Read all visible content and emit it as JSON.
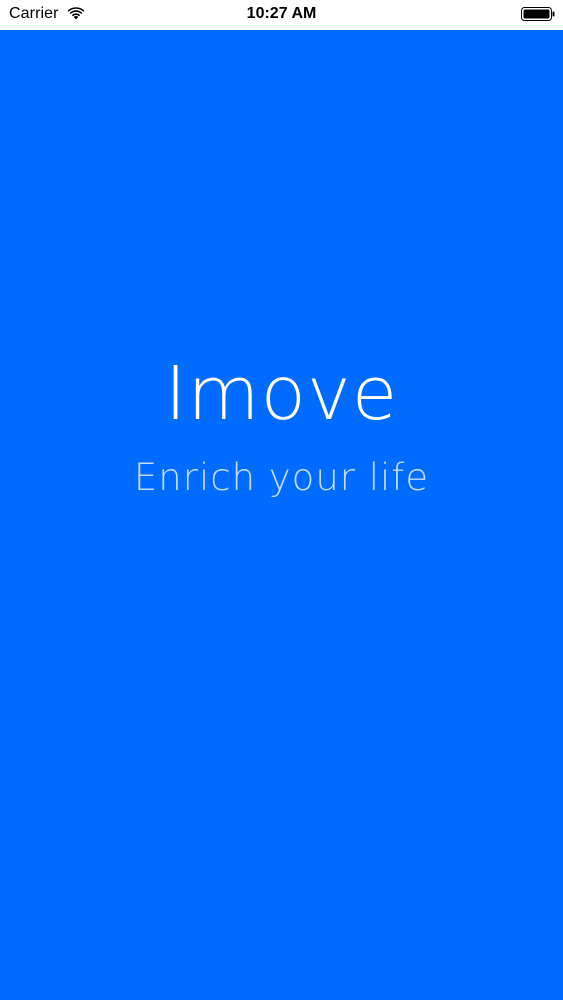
{
  "status_bar": {
    "carrier": "Carrier",
    "time": "10:27 AM",
    "wifi_icon": "wifi-icon",
    "battery_icon": "battery-icon"
  },
  "splash": {
    "title": "Imove",
    "subtitle": "Enrich your life"
  },
  "colors": {
    "background": "#006cff",
    "text": "#ffffff",
    "status_bar": "#ffffff"
  }
}
